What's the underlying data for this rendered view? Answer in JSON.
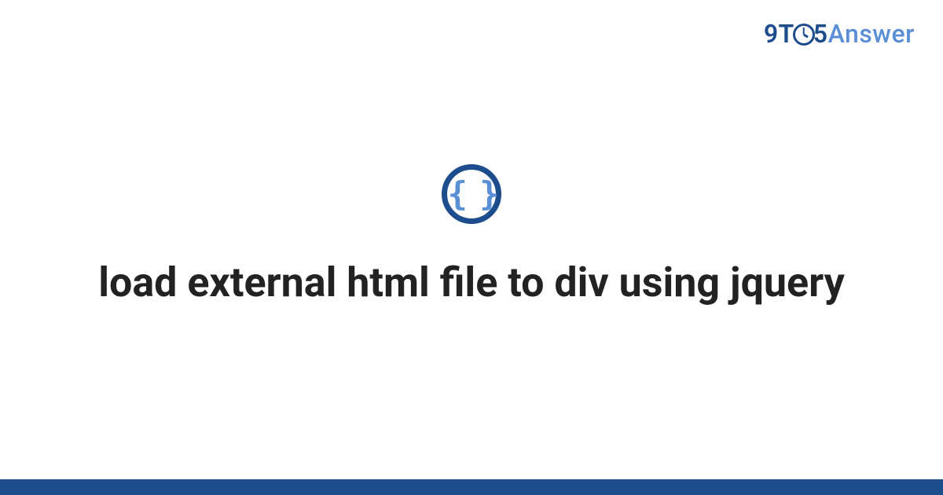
{
  "brand": {
    "part1": "9",
    "part2": "T",
    "part3": "5",
    "part4": "Answer"
  },
  "icon": {
    "name": "code-braces-icon",
    "glyph": "{ }"
  },
  "page": {
    "title": "load external html file to div using jquery"
  },
  "colors": {
    "primary": "#1d4d8c",
    "accent": "#5a8fd6"
  }
}
